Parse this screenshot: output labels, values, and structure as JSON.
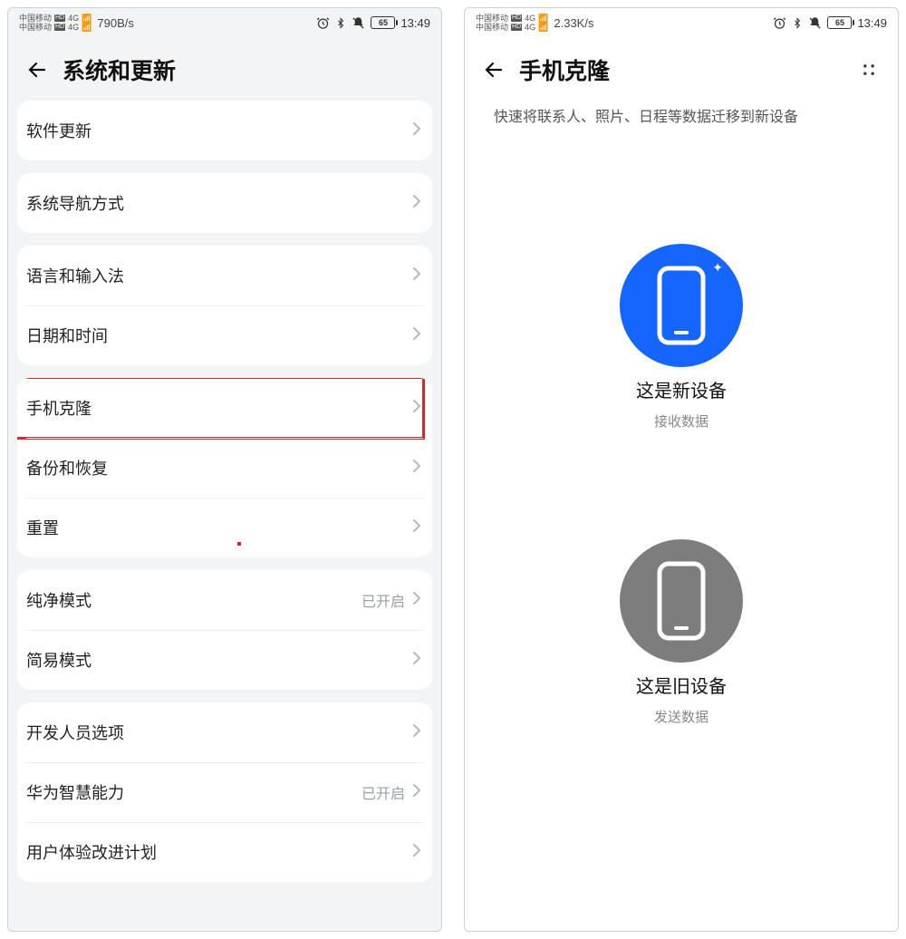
{
  "left": {
    "statusbar": {
      "carrier": "中国移动",
      "hd": "HD",
      "net": "4G",
      "speed": "790B/s",
      "battery": "65",
      "time": "13:49"
    },
    "header": {
      "title": "系统和更新"
    },
    "groups": [
      {
        "items": [
          {
            "label": "软件更新",
            "value": ""
          }
        ]
      },
      {
        "items": [
          {
            "label": "系统导航方式",
            "value": ""
          }
        ]
      },
      {
        "items": [
          {
            "label": "语言和输入法",
            "value": ""
          },
          {
            "label": "日期和时间",
            "value": ""
          }
        ]
      },
      {
        "items": [
          {
            "label": "手机克隆",
            "value": "",
            "highlighted": true
          },
          {
            "label": "备份和恢复",
            "value": ""
          },
          {
            "label": "重置",
            "value": ""
          }
        ]
      },
      {
        "items": [
          {
            "label": "纯净模式",
            "value": "已开启"
          },
          {
            "label": "简易模式",
            "value": ""
          }
        ]
      },
      {
        "items": [
          {
            "label": "开发人员选项",
            "value": ""
          },
          {
            "label": "华为智慧能力",
            "value": "已开启"
          },
          {
            "label": "用户体验改进计划",
            "value": ""
          }
        ]
      }
    ]
  },
  "right": {
    "statusbar": {
      "carrier": "中国移动",
      "hd": "HD",
      "net": "4G",
      "speed": "2.33K/s",
      "battery": "65",
      "time": "13:49"
    },
    "header": {
      "title": "手机克隆"
    },
    "subtitle": "快速将联系人、照片、日程等数据迁移到新设备",
    "options": {
      "new": {
        "title": "这是新设备",
        "sub": "接收数据"
      },
      "old": {
        "title": "这是旧设备",
        "sub": "发送数据"
      }
    }
  }
}
